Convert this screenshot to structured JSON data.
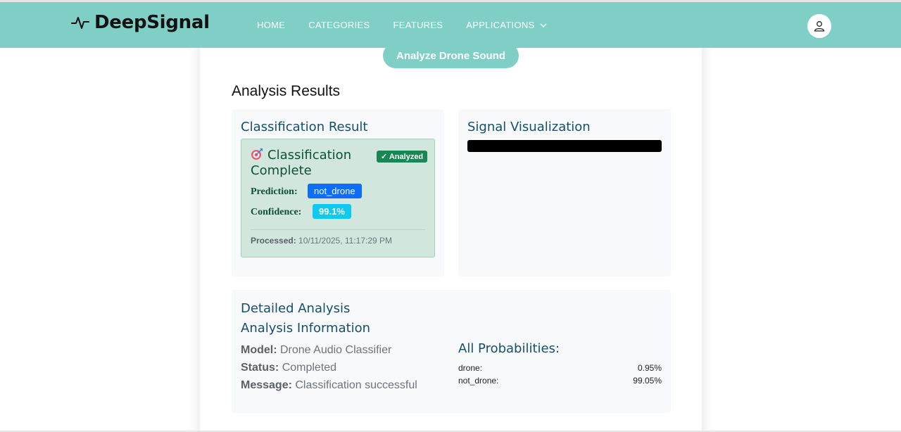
{
  "header": {
    "brand": "DeepSignal",
    "nav": [
      {
        "label": "HOME"
      },
      {
        "label": "CATEGORIES"
      },
      {
        "label": "FEATURES"
      },
      {
        "label": "APPLICATIONS"
      }
    ],
    "accent_color": "#80cfc6"
  },
  "main": {
    "analyze_button": "Analyze Drone Sound",
    "results_title": "Analysis Results",
    "classification": {
      "title": "Classification Result",
      "heading": "Classification Complete",
      "badge": "✓ Analyzed",
      "prediction_label": "Prediction:",
      "prediction_value": "not_drone",
      "confidence_label": "Confidence:",
      "confidence_value": "99.1%",
      "processed_label": "Processed:",
      "processed_value": "10/11/2025, 11:17:29 PM"
    },
    "visualization": {
      "title": "Signal Visualization"
    },
    "detailed": {
      "title": "Detailed Analysis",
      "subtitle": "Analysis Information",
      "model_label": "Model:",
      "model_value": "Drone Audio Classifier",
      "status_label": "Status:",
      "status_value": "Completed",
      "message_label": "Message:",
      "message_value": "Classification successful",
      "probabilities_title": "All Probabilities:",
      "probabilities": [
        {
          "label": "drone:",
          "value": "0.95%"
        },
        {
          "label": "not_drone:",
          "value": "99.05%"
        }
      ]
    }
  }
}
